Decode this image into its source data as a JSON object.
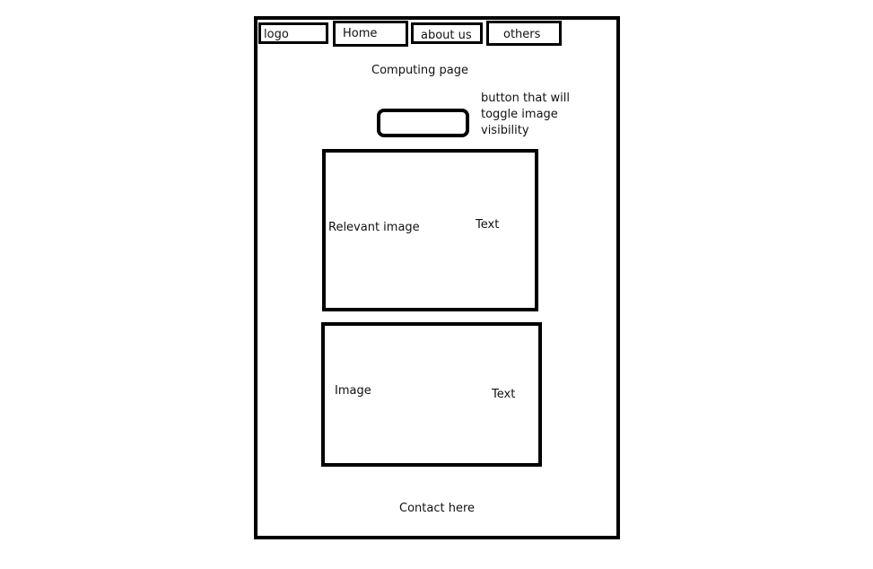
{
  "nav": {
    "logo": "logo",
    "home": "Home",
    "about": "about us",
    "others": "others"
  },
  "page_title": "Computing page",
  "toggle_button": {
    "annotation_line1": "button that will",
    "annotation_line2": "toggle image",
    "annotation_line3": "visibility"
  },
  "section1": {
    "image_label": "Relevant image",
    "text_label": "Text"
  },
  "section2": {
    "image_label": "Image",
    "text_label": "Text"
  },
  "footer": {
    "contact": "Contact here"
  }
}
